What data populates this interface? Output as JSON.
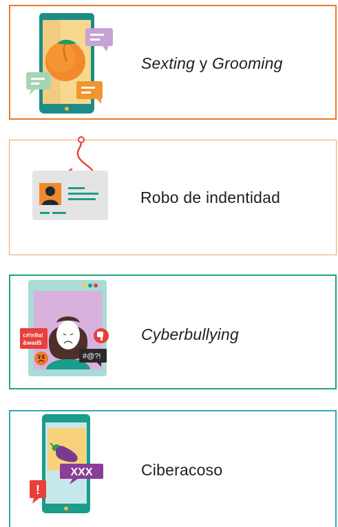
{
  "topics": [
    {
      "label_a": "Sexting",
      "label_conj": " y ",
      "label_b": "Grooming",
      "icon": "phone-peach-chat-icon",
      "border_color": "#e9782b"
    },
    {
      "label": "Robo de indentidad",
      "icon": "id-card-hook-icon",
      "border_color": "#f1a45c"
    },
    {
      "label": "Cyberbullying",
      "icon": "screen-person-insults-icon",
      "border_color": "#1ea27e"
    },
    {
      "label": "Ciberacoso",
      "icon": "phone-eggplant-xxx-icon",
      "border_color": "#31a8b6"
    }
  ],
  "cyberbullying_icon": {
    "insult_1a": "c#!n9a!",
    "insult_1b": "&wad5",
    "insult_2": "#@?!"
  },
  "ciberacoso_icon": {
    "badge": "XXX",
    "alert": "!"
  }
}
